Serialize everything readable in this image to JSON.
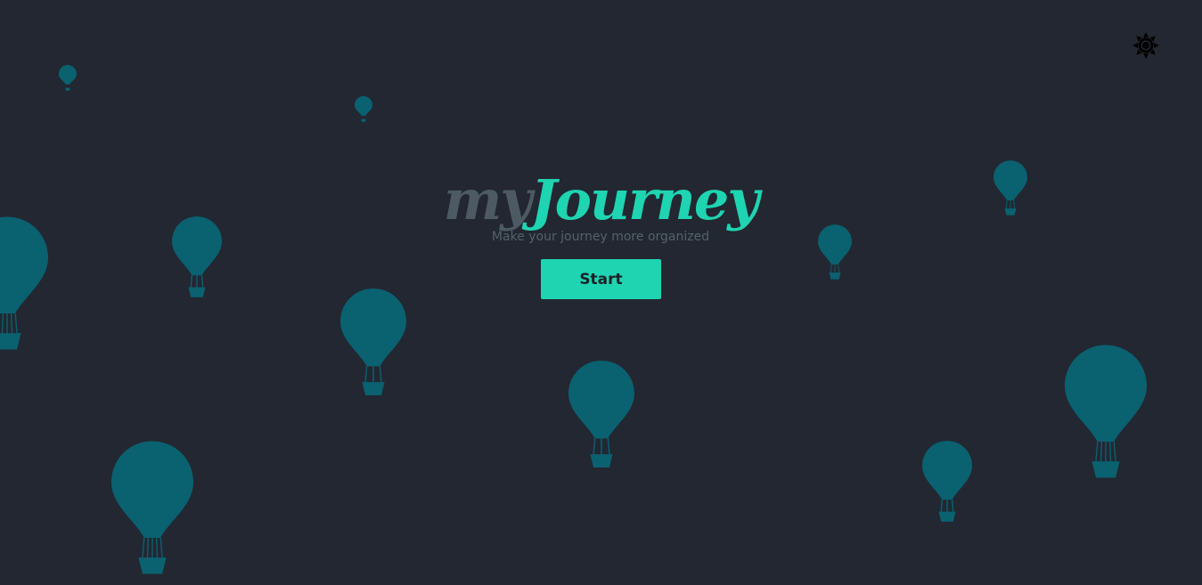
{
  "colors": {
    "background": "#222731",
    "accent": "#1fd4b1",
    "balloon": "#0a6170",
    "logo_muted": "#4d5a64",
    "tagline": "#55626b"
  },
  "brand": {
    "logo_prefix": "my",
    "logo_main": "Journey",
    "tagline": "Make your journey more organized"
  },
  "actions": {
    "start_label": "Start"
  },
  "header": {
    "theme_toggle_icon": "sun-icon"
  },
  "decorations": {
    "background_icon": "hot-air-balloon-icon"
  }
}
